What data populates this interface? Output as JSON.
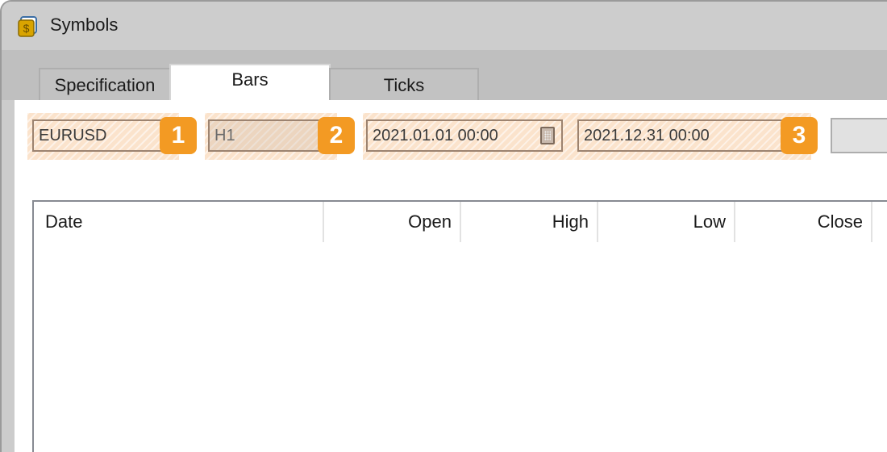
{
  "window": {
    "title": "Symbols",
    "icon": "dollar-coin-icon"
  },
  "tabs": [
    {
      "label": "Specification",
      "active": false
    },
    {
      "label": "Bars",
      "active": true
    },
    {
      "label": "Ticks",
      "active": false
    }
  ],
  "controls": {
    "symbol": {
      "value": "EURUSD",
      "badge": "1"
    },
    "timeframe": {
      "value": "H1",
      "badge": "2",
      "disabled": true
    },
    "date_from": {
      "value": "2021.01.01 00:00",
      "icon": "calendar-icon"
    },
    "date_to": {
      "value": "2021.12.31 00:00",
      "badge": "3"
    },
    "request_button": {
      "label": ""
    }
  },
  "table": {
    "columns": [
      "Date",
      "Open",
      "High",
      "Low",
      "Close"
    ],
    "rows": []
  },
  "colors": {
    "highlight": "#fbe3cc",
    "badge": "#f39a23"
  }
}
